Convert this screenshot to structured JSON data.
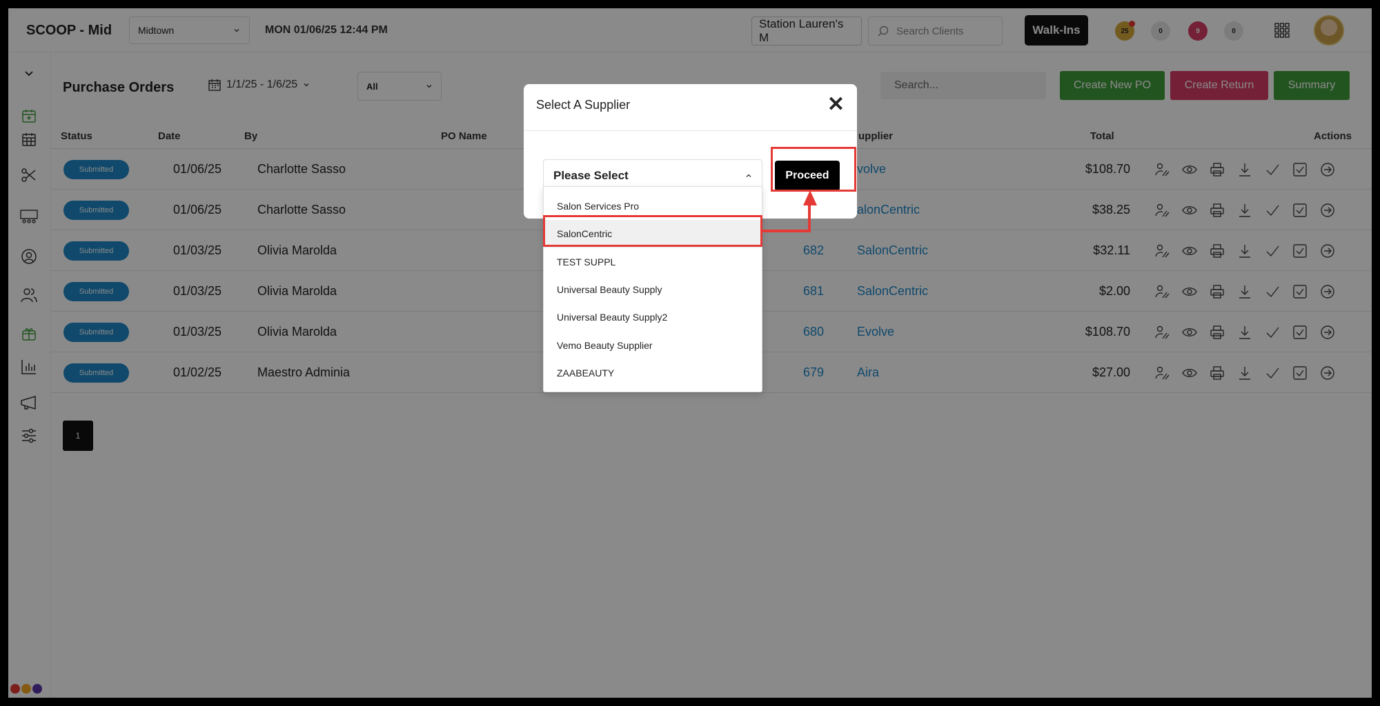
{
  "app": {
    "brand": "SCOOP - Mid",
    "location": "Midtown",
    "datetime": "MON 01/06/25  12:44 PM",
    "station": "Station Lauren's M",
    "search_placeholder": "Search Clients",
    "walkins_label": "Walk-Ins",
    "badges": [
      {
        "count": "25",
        "color": "#d4a83a"
      },
      {
        "count": "0",
        "color": "#e6e6e6"
      },
      {
        "count": "9",
        "color": "#d63c66"
      },
      {
        "count": "0",
        "color": "#e6e6e6"
      }
    ]
  },
  "sidebar": {
    "icons": [
      "chevron-down-icon",
      "calendar-add-icon",
      "calendar-grid-icon",
      "scissors-icon",
      "group-icon",
      "user-circle-icon",
      "users-icon",
      "gift-box-icon",
      "bar-chart-icon",
      "megaphone-icon",
      "sliders-icon"
    ],
    "dot_colors": [
      "#e53935",
      "#f5a623",
      "#5c35a8"
    ]
  },
  "page": {
    "title": "Purchase Orders",
    "date_range": "1/1/25 - 1/6/25",
    "filter_value": "All",
    "search_placeholder": "Search...",
    "create_new_label": "Create New PO",
    "create_return_label": "Create Return",
    "summary_label": "Summary"
  },
  "table": {
    "headers": {
      "status": "Status",
      "date": "Date",
      "by": "By",
      "po_name": "PO Name",
      "supplier": "upplier",
      "total": "Total",
      "actions": "Actions"
    },
    "rows": [
      {
        "status": "Submitted",
        "date": "01/06/25",
        "by": "Charlotte Sasso",
        "po": "",
        "supplier": "volve",
        "total": "$108.70"
      },
      {
        "status": "Submitted",
        "date": "01/06/25",
        "by": "Charlotte Sasso",
        "po": "",
        "supplier": "alonCentric",
        "total": "$38.25"
      },
      {
        "status": "Submitted",
        "date": "01/03/25",
        "by": "Olivia Marolda",
        "po": "682",
        "supplier": "SalonCentric",
        "total": "$32.11"
      },
      {
        "status": "Submitted",
        "date": "01/03/25",
        "by": "Olivia Marolda",
        "po": "681",
        "supplier": "SalonCentric",
        "total": "$2.00"
      },
      {
        "status": "Submitted",
        "date": "01/03/25",
        "by": "Olivia Marolda",
        "po": "680",
        "supplier": "Evolve",
        "total": "$108.70"
      },
      {
        "status": "Submitted",
        "date": "01/02/25",
        "by": "Maestro Adminia",
        "po": "679",
        "supplier": "Aira",
        "total": "$27.00"
      }
    ],
    "action_icons": [
      "assign-icon",
      "eye-icon",
      "print-icon",
      "download-icon",
      "check-icon",
      "checkbox-icon",
      "arrow-right-circle-icon"
    ]
  },
  "pagination": {
    "current": "1"
  },
  "modal": {
    "title": "Select A Supplier",
    "close": "✕",
    "select_value": "Please Select",
    "proceed_label": "Proceed",
    "options": [
      "Salon Services Pro",
      "SalonCentric",
      "TEST SUPPL",
      "Universal Beauty Supply",
      "Universal Beauty Supply2",
      "Vemo Beauty Supplier",
      "ZAABEAUTY"
    ],
    "highlighted": "SalonCentric"
  },
  "annotation_color": "#e53935"
}
